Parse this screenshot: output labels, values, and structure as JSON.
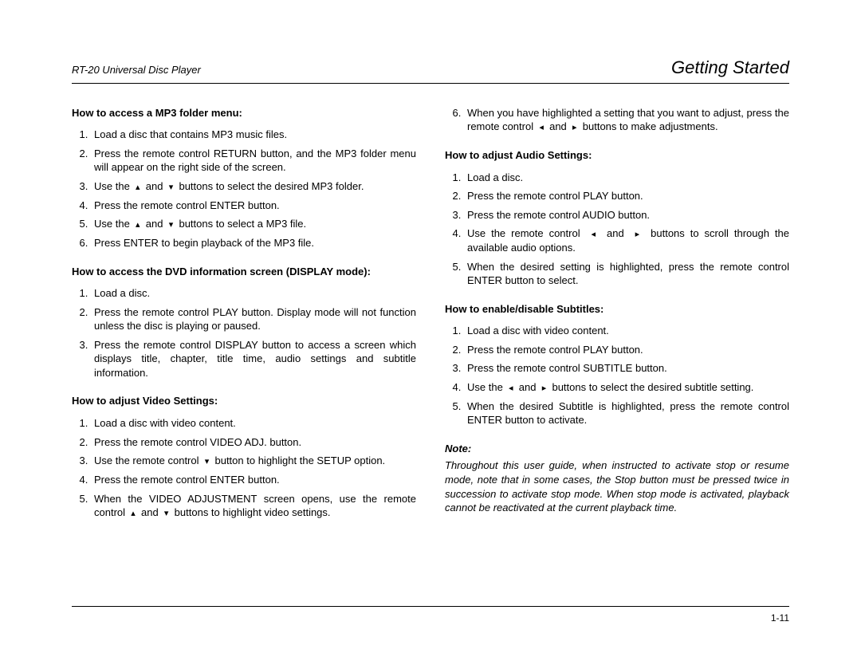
{
  "header": {
    "left": "RT-20 Universal Disc Player",
    "right": "Getting Started"
  },
  "footer": {
    "page_num": "1-11"
  },
  "glyphs": {
    "up": "▴",
    "down": "▾",
    "left": "◂",
    "right": "▸"
  },
  "left_col": {
    "sections": [
      {
        "title": "How to access a MP3 folder menu:",
        "items_html": [
          "Load a disc that contains MP3 music files.",
          "Press the remote control RETURN button, and the MP3 folder menu will appear on the right side of the screen.",
          "Use the &nbsp;<span class='glyph'>▴</span>&nbsp; and &nbsp;<span class='glyph'>▾</span>&nbsp; buttons to select the desired MP3 folder.",
          "Press the remote control ENTER button.",
          "Use the &nbsp;<span class='glyph'>▴</span>&nbsp; and &nbsp;<span class='glyph'>▾</span>&nbsp; buttons to select a MP3 file.",
          "Press ENTER to begin playback of the MP3 file."
        ]
      },
      {
        "title": "How to access the DVD information screen (DISPLAY mode):",
        "items_html": [
          "Load a disc.",
          "Press the remote control PLAY button. Display mode will not function unless the disc is playing or paused.",
          "Press the remote control DISPLAY button to access a screen which displays title, chapter, title time, audio settings and subtitle information."
        ]
      },
      {
        "title": "How to adjust Video Settings:",
        "items_html": [
          "Load a disc with video content.",
          "Press the remote control VIDEO ADJ. button.",
          "Use the remote control &nbsp;<span class='glyph'>▾</span>&nbsp; button to highlight the SETUP option.",
          "Press the remote control ENTER button.",
          "When the VIDEO ADJUSTMENT screen opens, use the remote control &nbsp;<span class='glyph'>▴</span>&nbsp; and &nbsp;<span class='glyph'>▾</span>&nbsp; buttons to highlight video settings."
        ]
      }
    ]
  },
  "right_col": {
    "continuation_start": 6,
    "continuation_items_html": [
      "When you have highlighted a setting that you want to adjust, press the remote control &nbsp;<span class='glyph'>◂</span>&nbsp; and &nbsp;<span class='glyph'>▸</span>&nbsp; buttons to make adjustments."
    ],
    "sections": [
      {
        "title": "How to adjust Audio Settings:",
        "items_html": [
          "Load a disc.",
          "Press the remote control PLAY button.",
          "Press the remote control AUDIO button.",
          "Use the remote control &nbsp;<span class='glyph'>◂</span>&nbsp; and &nbsp;<span class='glyph'>▸</span>&nbsp; buttons to scroll through the available audio options.",
          "When the desired setting is highlighted, press the remote control ENTER button to select."
        ]
      },
      {
        "title": "How to enable/disable Subtitles:",
        "items_html": [
          "Load a disc with video content.",
          "Press the remote control PLAY button.",
          "Press the remote control SUBTITLE button.",
          "Use the &nbsp;<span class='glyph'>◂</span>&nbsp; and &nbsp;<span class='glyph'>▸</span>&nbsp; buttons to select the desired subtitle setting.",
          "When the desired Subtitle is highlighted, press the remote control ENTER button to activate."
        ]
      }
    ],
    "note": {
      "label": "Note:",
      "body": "Throughout this user guide, when instructed to activate stop or resume mode, note that in some cases, the Stop button must be pressed twice in succession to activate stop mode. When stop mode is activated, playback cannot be reactivated at the current playback time."
    }
  }
}
